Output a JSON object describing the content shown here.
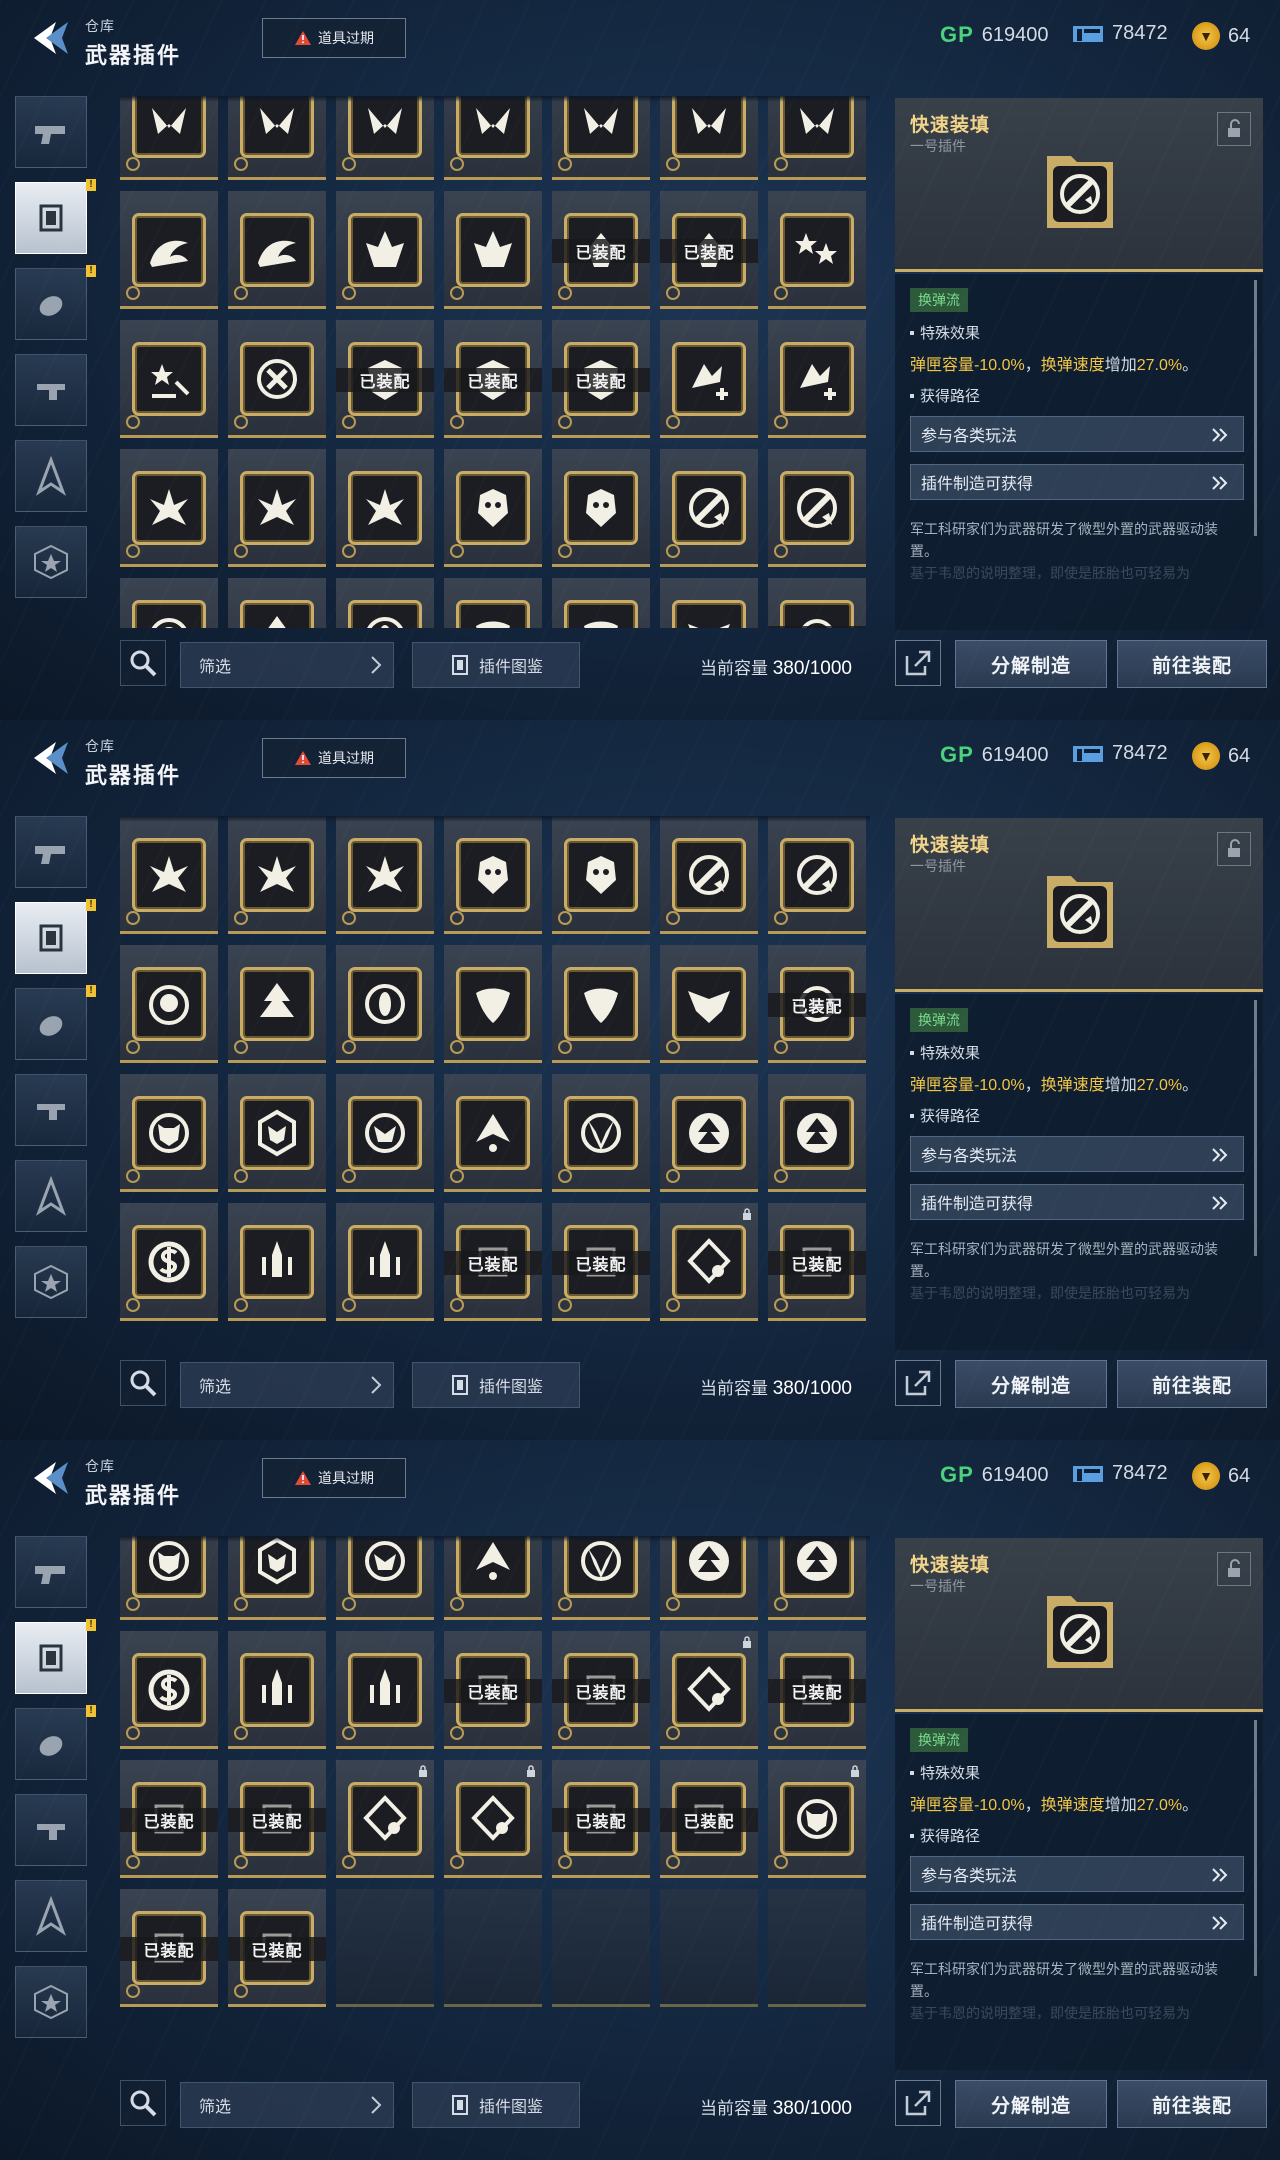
{
  "header": {
    "subtitle": "仓库",
    "title": "武器插件",
    "expire_label": "道具过期",
    "gp_label": "GP",
    "gp_value": "619400",
    "ticket_value": "78472",
    "coin_value": "64"
  },
  "side_nav": [
    "pistol-icon",
    "plugin-chip-icon",
    "grenade-icon",
    "rifle-part-icon",
    "compass-icon",
    "star-badge-icon"
  ],
  "bottom": {
    "filter_label": "筛选",
    "codex_label": "插件图鉴",
    "capacity_label": "当前容量",
    "capacity_value": "380/1000"
  },
  "detail": {
    "name": "快速装填",
    "slot": "一号插件",
    "tag": "换弹流",
    "effect_title": "特殊效果",
    "effect_a": "弹匣容量-10.0%",
    "effect_sep": "，",
    "effect_b": "换弹速度",
    "effect_mid": "增加",
    "effect_c": "27.0%",
    "effect_end": "。",
    "route_title": "获得路径",
    "route_1": "参与各类玩法",
    "route_2": "插件制造可获得",
    "desc": "军工科研家们为武器研发了微型外置的武器驱动装置。",
    "desc_faded": "基于韦恩的说明整理，即使是胚胎也可轻易为"
  },
  "actions": {
    "decompose": "分解制造",
    "go_equip": "前往装配"
  },
  "equipped_label": "已装配",
  "colors": {
    "gold": "#c9ac66",
    "effect_yellow": "#f2c545",
    "tag_green": "#79d98d",
    "gp_green": "#4bd27a"
  },
  "panels": [
    {
      "rows": [
        [
          "wings-crest",
          "wings-crest",
          "wings-crest",
          "wings-crest",
          "wings-crest",
          "wings-crest",
          "wings-crest"
        ],
        [
          "dragon",
          "dragon",
          "crown-leaf",
          "crown-leaf",
          "skull-wing:eq",
          "skull-wing:eq",
          "stars"
        ],
        [
          "stars-small",
          "x-circle",
          "shield:eq",
          "shield:eq",
          "shield:eq",
          "claw-plus",
          "claw-plus"
        ],
        [
          "flower",
          "flower",
          "flower",
          "mask",
          "mask",
          "reload",
          "reload"
        ],
        [
          "bear",
          "tree",
          "eye",
          "leaf",
          "leaf",
          "bat",
          "gear:eq"
        ]
      ]
    },
    {
      "rows": [
        [
          "flower",
          "flower",
          "flower",
          "mask",
          "mask",
          "reload",
          "reload"
        ],
        [
          "bear",
          "tree",
          "eye",
          "leaf",
          "leaf",
          "bat",
          "gear:eq"
        ],
        [
          "wolf",
          "wolf-up",
          "wolf-down",
          "chevrons",
          "horns",
          "tri-up",
          "tri-up"
        ],
        [
          "dollar",
          "blade",
          "blade",
          "blank:eq",
          "blank:eq",
          "dice:lock",
          "blank:eq"
        ]
      ]
    },
    {
      "rows": [
        [
          "wolf",
          "wolf-up",
          "wolf-down",
          "chevrons",
          "horns",
          "tri-up",
          "tri-up"
        ],
        [
          "dollar",
          "blade",
          "blade",
          "blank:eq",
          "blank:eq",
          "dice:lock",
          "blank:eq"
        ],
        [
          "blank:eq",
          "blank:eq",
          "dice:lock",
          "dice:lock",
          "blank:eq",
          "blank:eq",
          "wolf:lock"
        ],
        [
          "blank:eq",
          "blank:eq",
          "empty",
          "empty",
          "empty",
          "empty",
          "empty"
        ]
      ]
    }
  ]
}
